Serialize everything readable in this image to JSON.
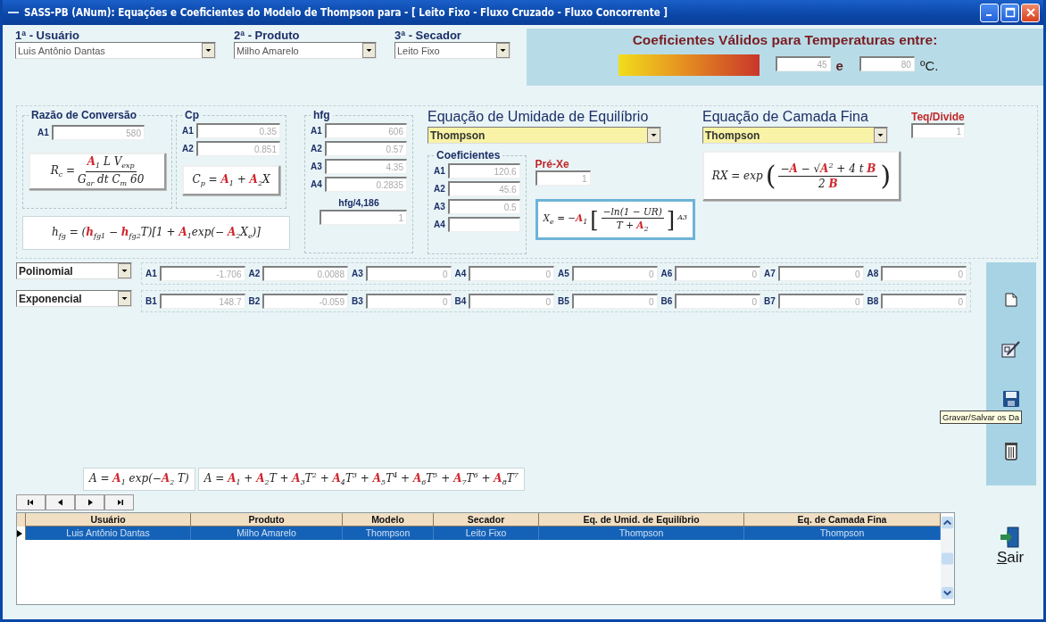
{
  "window": {
    "title": "SASS-PB (ANum): Equações e Coeficientes do Modelo de Thompson para - [ Leito Fixo - Fluxo Cruzado - Fluxo Concorrente ]"
  },
  "selectors": [
    {
      "label": "1ª - Usuário",
      "value": "Luis Antônio Dantas"
    },
    {
      "label": "2ª - Produto",
      "value": "Milho Amarelo"
    },
    {
      "label": "3ª - Secador",
      "value": "Leito Fixo"
    }
  ],
  "temperature": {
    "title": "Coeficientes Válidos para Temperaturas entre:",
    "min": "45",
    "separator": "e",
    "max": "80",
    "unit": "ºC."
  },
  "conversion": {
    "title": "Razão de Conversão",
    "fields": [
      {
        "label": "A1",
        "value": "580"
      }
    ],
    "formula": {
      "kind": "raised",
      "parts": [
        {
          "kind": "text",
          "text": "R$_{c}$ ="
        },
        {
          "kind": "fraction",
          "num": "**A**$_{1}$ L V$_{exp}$",
          "den": "G$_{ar}$ dt C$_{m}$ 60"
        }
      ]
    }
  },
  "cp": {
    "title": "Cp",
    "fields": [
      {
        "label": "A1",
        "value": "0.35"
      },
      {
        "label": "A2",
        "value": "0.851"
      }
    ],
    "formula": {
      "kind": "raised",
      "parts": [
        {
          "kind": "text",
          "text": "C$_{p}$ = **A**$_{1}$ + **A**$_{2}$X"
        }
      ]
    }
  },
  "hfg_formula": {
    "kind": "flat",
    "parts": [
      {
        "kind": "text",
        "text": "h$_{fg}$ = (**h**$_{fg1}$ − **h**$_{fg2}$T)[1 + **A**$_{1}$exp(− **A**$_{2}$X$_{e}$)]"
      }
    ]
  },
  "hfg": {
    "title": "hfg",
    "fields": [
      {
        "label": "A1",
        "value": "606"
      },
      {
        "label": "A2",
        "value": "0.57"
      },
      {
        "label": "A3",
        "value": "4.35"
      },
      {
        "label": "A4",
        "value": "0.2835"
      }
    ],
    "divisor_label": "hfg/4,186",
    "divisor_value": "1"
  },
  "equilibrium": {
    "title": "Equação de Umidade de Equilíbrio",
    "model": "Thompson",
    "coefficients_title": "Coeficientes",
    "fields": [
      {
        "label": "A1",
        "value": "120.6"
      },
      {
        "label": "A2",
        "value": "45.6"
      },
      {
        "label": "A3",
        "value": "0.5"
      },
      {
        "label": "A4"
      }
    ],
    "pre_xe": {
      "label": "Pré-Xe",
      "value": "1"
    },
    "formula": {
      "kind": "blue",
      "parts": [
        {
          "kind": "text",
          "text": "X$_{e}$ = −**A**$_{1}$"
        },
        {
          "kind": "bracket",
          "text": "["
        },
        {
          "kind": "fraction",
          "num": "−ln(1 − UR)",
          "den": "T + **A**$_{2}$"
        },
        {
          "kind": "bracket",
          "text": "]"
        },
        {
          "kind": "text",
          "text": "$^{A3}$"
        }
      ]
    }
  },
  "thin_layer": {
    "title": "Equação de Camada Fina",
    "model": "Thompson",
    "formula": {
      "kind": "raised",
      "parts": [
        {
          "kind": "text",
          "text": "RX = exp"
        },
        {
          "kind": "bracket",
          "text": "("
        },
        {
          "kind": "fraction",
          "num": "−**A** − √**A**$^{2}$ + 4 t **B**",
          "den": "2 **B**"
        },
        {
          "kind": "bracket",
          "text": ")"
        }
      ]
    }
  },
  "teq": {
    "label": "Teq/Divide",
    "value": "1"
  },
  "series": [
    {
      "type": "Polinomial",
      "fields": [
        {
          "label": "A1",
          "value": "-1.706"
        },
        {
          "label": "A2",
          "value": "0.0088"
        },
        {
          "label": "A3",
          "value": "0"
        },
        {
          "label": "A4",
          "value": "0"
        },
        {
          "label": "A5",
          "value": "0"
        },
        {
          "label": "A6",
          "value": "0"
        },
        {
          "label": "A7",
          "value": "0"
        },
        {
          "label": "A8",
          "value": "0"
        }
      ]
    },
    {
      "type": "Exponencial",
      "fields": [
        {
          "label": "B1",
          "value": "148.7"
        },
        {
          "label": "B2",
          "value": "-0.059"
        },
        {
          "label": "B3",
          "value": "0"
        },
        {
          "label": "B4",
          "value": "0"
        },
        {
          "label": "B5",
          "value": "0"
        },
        {
          "label": "B6",
          "value": "0"
        },
        {
          "label": "B7",
          "value": "0"
        },
        {
          "label": "B8",
          "value": "0"
        }
      ]
    }
  ],
  "tooltip": "Gravar/Salvar os Da",
  "formulas": [
    {
      "kind": "flat",
      "parts": [
        {
          "kind": "text",
          "text": "A = **A**$_{1}$ exp(−**A**$_{2}$ T)"
        }
      ]
    },
    {
      "kind": "flat",
      "parts": [
        {
          "kind": "text",
          "text": "A = **A**$_{1}$ + **A**$_{2}$T + **A**$_{3}$T$^{2}$ + **A**$_{4}$T$^{3}$ + **A**$_{5}$T$^{4}$ + **A**$_{6}$T$^{5}$ + **A**$_{7}$T$^{6}$ + **A**$_{8}$T$^{7}$"
        }
      ]
    }
  ],
  "grid": {
    "columns": [
      "Usuário",
      "Produto",
      "Modelo",
      "Secador",
      "Eq. de Umid. de Equilíbrio",
      "Eq. de Camada Fina"
    ],
    "rows": [
      {
        "selected": true,
        "cells": [
          "Luis Antônio Dantas",
          "Milho Amarelo",
          "Thompson",
          "Leito Fixo",
          "Thompson",
          "Thompson"
        ]
      }
    ]
  },
  "exit": {
    "label": "Sair"
  }
}
